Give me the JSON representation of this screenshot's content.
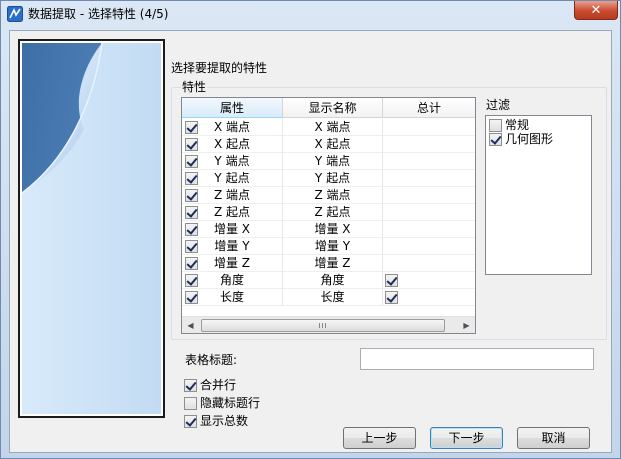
{
  "window": {
    "title": "数据提取 - 选择特性 (4/5)",
    "close_glyph": "✕"
  },
  "heading": "选择要提取的特性",
  "properties_group": {
    "title": "特性",
    "columns": [
      "属性",
      "显示名称",
      "总计"
    ],
    "rows": [
      {
        "checked": true,
        "attribute": "X 端点",
        "display": "X 端点",
        "total": null
      },
      {
        "checked": true,
        "attribute": "X 起点",
        "display": "X 起点",
        "total": null
      },
      {
        "checked": true,
        "attribute": "Y 端点",
        "display": "Y 端点",
        "total": null
      },
      {
        "checked": true,
        "attribute": "Y 起点",
        "display": "Y 起点",
        "total": null
      },
      {
        "checked": true,
        "attribute": "Z 端点",
        "display": "Z 端点",
        "total": null
      },
      {
        "checked": true,
        "attribute": "Z 起点",
        "display": "Z 起点",
        "total": null
      },
      {
        "checked": true,
        "attribute": "增量 X",
        "display": "增量 X",
        "total": null
      },
      {
        "checked": true,
        "attribute": "增量 Y",
        "display": "增量 Y",
        "total": null
      },
      {
        "checked": true,
        "attribute": "增量 Z",
        "display": "增量 Z",
        "total": null
      },
      {
        "checked": true,
        "attribute": "角度",
        "display": "角度",
        "total": true
      },
      {
        "checked": true,
        "attribute": "长度",
        "display": "长度",
        "total": true
      }
    ],
    "scroll_grip": "III"
  },
  "filter": {
    "title": "过滤",
    "items": [
      {
        "label": "常规",
        "checked": false
      },
      {
        "label": "几何图形",
        "checked": true
      }
    ]
  },
  "table_title": {
    "label": "表格标题:",
    "value": ""
  },
  "options": [
    {
      "label": "合并行",
      "checked": true
    },
    {
      "label": "隐藏标题行",
      "checked": false
    },
    {
      "label": "显示总数",
      "checked": true
    }
  ],
  "buttons": {
    "back": "上一步",
    "next": "下一步",
    "cancel": "取消"
  },
  "colors": {
    "accent": "#3c7fb1",
    "close_button": "#c94b2f"
  }
}
